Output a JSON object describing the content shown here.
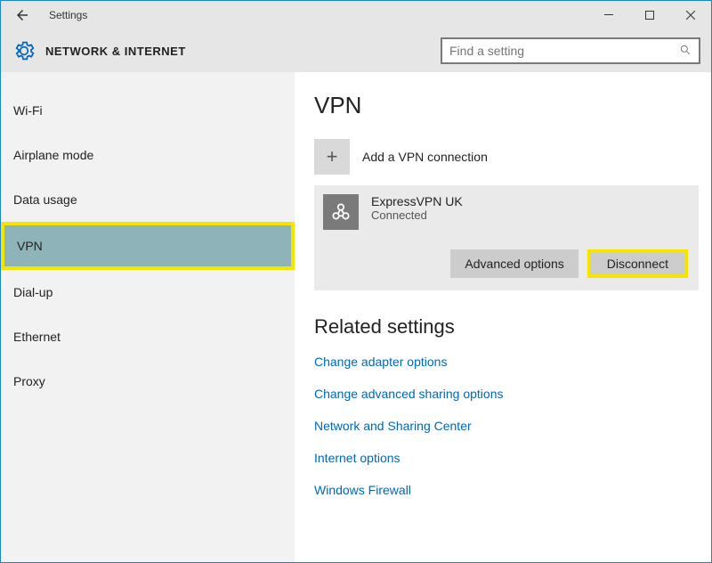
{
  "window": {
    "title": "Settings"
  },
  "header": {
    "section": "NETWORK & INTERNET",
    "search_placeholder": "Find a setting"
  },
  "sidebar": {
    "items": [
      {
        "label": "Wi-Fi",
        "selected": false
      },
      {
        "label": "Airplane mode",
        "selected": false
      },
      {
        "label": "Data usage",
        "selected": false
      },
      {
        "label": "VPN",
        "selected": true
      },
      {
        "label": "Dial-up",
        "selected": false
      },
      {
        "label": "Ethernet",
        "selected": false
      },
      {
        "label": "Proxy",
        "selected": false
      }
    ]
  },
  "main": {
    "page_title": "VPN",
    "add_connection_label": "Add a VPN connection",
    "connection": {
      "name": "ExpressVPN UK",
      "status": "Connected",
      "advanced_label": "Advanced options",
      "disconnect_label": "Disconnect"
    },
    "related_heading": "Related settings",
    "related_links": [
      "Change adapter options",
      "Change advanced sharing options",
      "Network and Sharing Center",
      "Internet options",
      "Windows Firewall"
    ]
  }
}
